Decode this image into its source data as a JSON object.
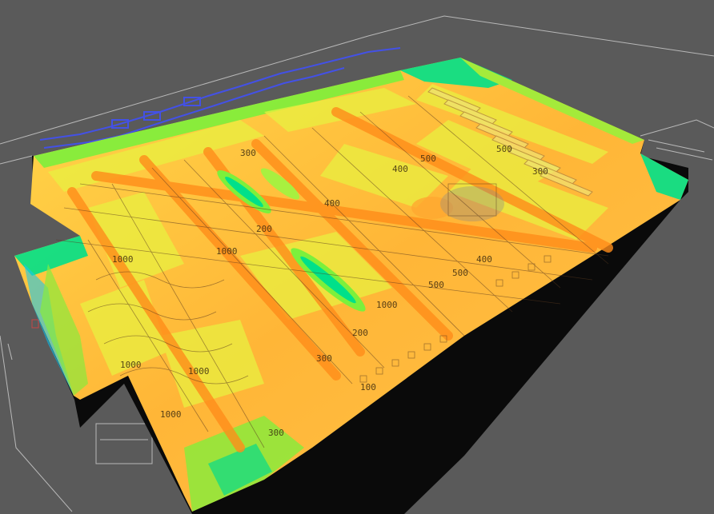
{
  "scene": {
    "background_color": "#5a5a5a",
    "slab_side_color": "#0a0a0a",
    "cad_line_color": "#cfcfcf",
    "heatmap_colors": [
      "#00c8ff",
      "#00e08a",
      "#7cf03c",
      "#e8f040",
      "#ffd23c",
      "#ffa830",
      "#ff8c1a"
    ],
    "contour_labels": [
      "300",
      "200",
      "400",
      "500",
      "400",
      "1000",
      "1000",
      "1000",
      "200",
      "300",
      "500",
      "500",
      "400",
      "500",
      "300",
      "1000",
      "1000",
      "1000",
      "300",
      "100"
    ]
  }
}
